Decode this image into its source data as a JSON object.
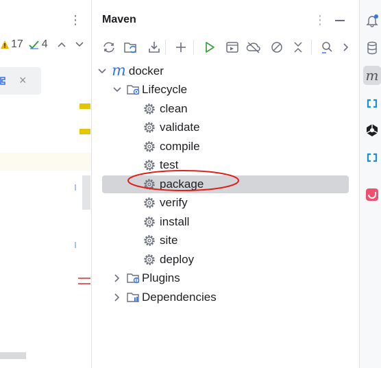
{
  "editor": {
    "inspection": {
      "warnings": "17",
      "ok": "4"
    },
    "tab_close": "×"
  },
  "maven": {
    "title": "Maven",
    "toolbar": [
      "reload-icon",
      "generate-sources-icon",
      "download-icon",
      "add-icon",
      "run-icon",
      "execute-goal-icon",
      "offline-icon",
      "skip-tests-icon",
      "collapse-icon",
      "analyze-icon",
      "more-icon"
    ],
    "tree": {
      "root": {
        "label": "docker",
        "icon_glyph": "m"
      },
      "lifecycle": {
        "label": "Lifecycle",
        "phases": [
          "clean",
          "validate",
          "compile",
          "test",
          "package",
          "verify",
          "install",
          "site",
          "deploy"
        ],
        "selected": "package"
      },
      "plugins": {
        "label": "Plugins"
      },
      "dependencies": {
        "label": "Dependencies"
      }
    }
  },
  "colors": {
    "accent_blue": "#3574f0",
    "run_green": "#3b9e41",
    "selection": "#d4d5d8",
    "callout_red": "#e0201b",
    "warning_yellow": "#f0b400"
  },
  "right_strip": {
    "buttons": [
      "notifications-icon",
      "database-icon",
      "maven-icon",
      "ai-assistant-icon",
      "plugin-icon",
      "ai-assistant-icon-2",
      "app-icon"
    ]
  }
}
